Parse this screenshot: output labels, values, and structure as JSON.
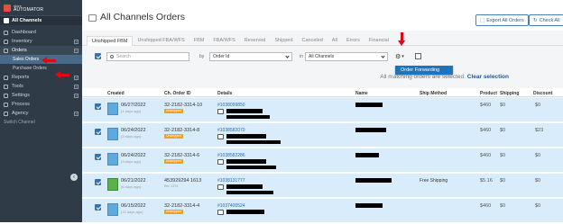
{
  "sidebar": {
    "brand_store": "store",
    "brand_name": "AUTOMATOR",
    "channel_title": "All Channels",
    "items": [
      {
        "label": "Dashboard"
      },
      {
        "label": "Inventory"
      },
      {
        "label": "Orders"
      },
      {
        "label": "Sales Orders"
      },
      {
        "label": "Purchase Orders"
      },
      {
        "label": "Reports"
      },
      {
        "label": "Tools"
      },
      {
        "label": "Settings"
      },
      {
        "label": "Process"
      },
      {
        "label": "Agency"
      }
    ],
    "switch_channel": "Switch Channel"
  },
  "header": {
    "title": "All Channels Orders",
    "export_label": "Export All Orders",
    "check_label": "Check All"
  },
  "tabs": [
    "Unshipped FBM",
    "Unshipped FBA/WFS",
    "FBM",
    "FBA/WFS",
    "Reserved",
    "Shipped",
    "Canceled",
    "All",
    "Errors",
    "Financial"
  ],
  "filters": {
    "search_placeholder": "Search",
    "by_label": "by",
    "field_value": "Order Id",
    "in_label": "in",
    "channel_value": "All Channels"
  },
  "menu": {
    "order_forwarding": "Order Forwarding"
  },
  "notice": {
    "text": "All matching orders are selected.",
    "clear": "Clear selection"
  },
  "table": {
    "columns": [
      "Created",
      "Ch. Order ID",
      "Details",
      "Name",
      "Ship Method",
      "Product",
      "Shipping",
      "Discount"
    ],
    "rows": [
      {
        "date": "06/27/2022",
        "ago": "(1 days ago)",
        "order_id": "32-2182-3314-10",
        "badge": "Unshipped",
        "link": "#1038099850",
        "ship_method": "",
        "product": "$460",
        "shipping": "$0",
        "discount": "$0",
        "thumb": "blue"
      },
      {
        "date": "06/24/2022",
        "ago": "(3 days ago)",
        "order_id": "32-2182-3314-8",
        "badge": "Unshipped",
        "link": "#1038582070",
        "ship_method": "",
        "product": "$460",
        "shipping": "$0",
        "discount": "$23",
        "thumb": "blue"
      },
      {
        "date": "06/24/2022",
        "ago": "(3 days ago)",
        "order_id": "32-2182-3314-6",
        "badge": "Unshipped",
        "link": "#1038582286",
        "ship_method": "",
        "product": "$460",
        "shipping": "$0",
        "discount": "$0",
        "thumb": "blue"
      },
      {
        "date": "06/21/2022",
        "ago": "(6 days ago)",
        "order_id": "453929294 1613",
        "badge": "Ref. 1374",
        "link": "#1038131777",
        "ship_method": "Free Shipping",
        "product": "$5.16",
        "shipping": "$0",
        "discount": "$0",
        "thumb": "green"
      },
      {
        "date": "06/15/2022",
        "ago": "(12 days ago)",
        "order_id": "32-2182-3314-4",
        "badge": "Unshipped",
        "link": "#1037400524",
        "ship_method": "",
        "product": "$460",
        "shipping": "$0",
        "discount": "$0",
        "thumb": "blue"
      }
    ]
  },
  "colors": {
    "sidebar_bg": "#2f3b47",
    "row_highlight": "#d9ecfb",
    "accent": "#1e73be",
    "annotation_arrow": "#e30613"
  }
}
